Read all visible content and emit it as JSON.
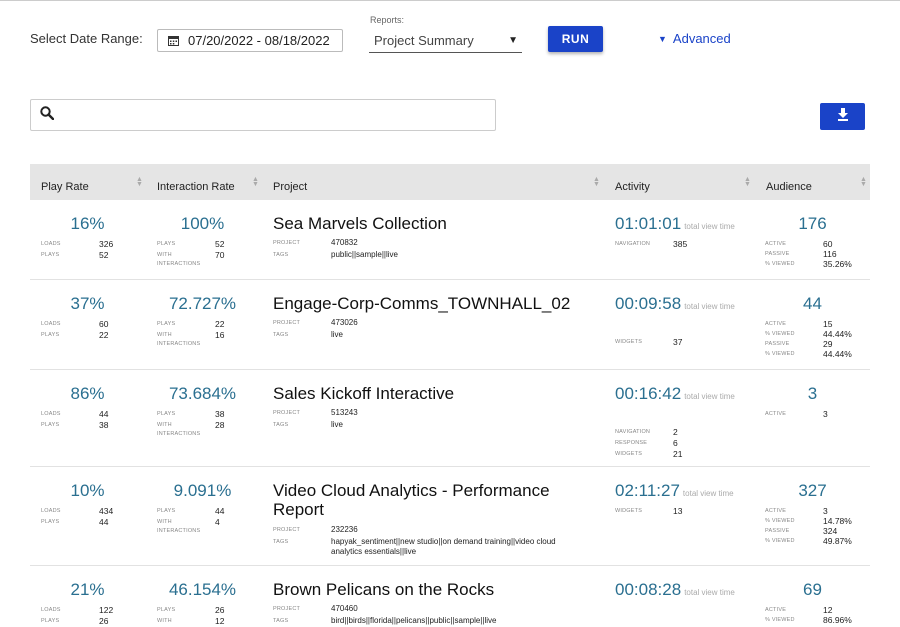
{
  "filters": {
    "date_label": "Select Date Range:",
    "date_value": "07/20/2022 - 08/18/2022",
    "reports_caption": "Reports:",
    "reports_value": "Project Summary",
    "run_label": "RUN",
    "advanced_label": "Advanced"
  },
  "search": {
    "placeholder": ""
  },
  "table": {
    "columns": [
      "Play Rate",
      "Interaction Rate",
      "Project",
      "Activity",
      "Audience"
    ],
    "rows": [
      {
        "play_rate": "16%",
        "loads": "326",
        "plays": "52",
        "interaction_rate": "100%",
        "ir_plays": "52",
        "with_interactions": "70",
        "title": "Sea Marvels Collection",
        "project": "470832",
        "tags": "public||sample||live",
        "activity_time": "01:01:01",
        "activity_label": "total view time",
        "activity_items": [
          {
            "k": "NAVIGATION",
            "v": "385"
          }
        ],
        "audience": "176",
        "audience_items": [
          {
            "k": "ACTIVE",
            "v": "60"
          },
          {
            "k": "PASSIVE",
            "v": "116"
          },
          {
            "k": "% VIEWED",
            "v": "35.26%"
          }
        ]
      },
      {
        "play_rate": "37%",
        "loads": "60",
        "plays": "22",
        "interaction_rate": "72.727%",
        "ir_plays": "22",
        "with_interactions": "16",
        "title": "Engage-Corp-Comms_TOWNHALL_02",
        "project": "473026",
        "tags": "live",
        "activity_time": "00:09:58",
        "activity_label": "total view time",
        "activity_items": [
          {
            "k": "WIDGETS",
            "v": "37"
          }
        ],
        "audience": "44",
        "audience_items": [
          {
            "k": "ACTIVE",
            "v": "15"
          },
          {
            "k": "% VIEWED",
            "v": "44.44%"
          },
          {
            "k": "PASSIVE",
            "v": "29"
          },
          {
            "k": "% VIEWED",
            "v": "44.44%"
          }
        ]
      },
      {
        "play_rate": "86%",
        "loads": "44",
        "plays": "38",
        "interaction_rate": "73.684%",
        "ir_plays": "38",
        "with_interactions": "28",
        "title": "Sales Kickoff Interactive",
        "project": "513243",
        "tags": "live",
        "activity_time": "00:16:42",
        "activity_label": "total view time",
        "activity_items": [
          {
            "k": "NAVIGATION",
            "v": "2"
          },
          {
            "k": "RESPONSE",
            "v": "6"
          },
          {
            "k": "WIDGETS",
            "v": "21"
          }
        ],
        "audience": "3",
        "audience_items": [
          {
            "k": "ACTIVE",
            "v": "3"
          }
        ]
      },
      {
        "play_rate": "10%",
        "loads": "434",
        "plays": "44",
        "interaction_rate": "9.091%",
        "ir_plays": "44",
        "with_interactions": "4",
        "title": "Video Cloud Analytics - Performance Report",
        "project": "232236",
        "tags": "hapyak_sentiment||new studio||on demand training||video cloud analytics essentials||live",
        "activity_time": "02:11:27",
        "activity_label": "total view time",
        "activity_items": [
          {
            "k": "WIDGETS",
            "v": "13"
          }
        ],
        "audience": "327",
        "audience_items": [
          {
            "k": "ACTIVE",
            "v": "3"
          },
          {
            "k": "% VIEWED",
            "v": "14.78%"
          },
          {
            "k": "PASSIVE",
            "v": "324"
          },
          {
            "k": "% VIEWED",
            "v": "49.87%"
          }
        ]
      },
      {
        "play_rate": "21%",
        "loads": "122",
        "plays": "26",
        "interaction_rate": "46.154%",
        "ir_plays": "26",
        "with_interactions": "12",
        "title": "Brown Pelicans on the Rocks",
        "project": "470460",
        "tags": "bird||birds||florida||pelicans||public||sample||live",
        "activity_time": "00:08:28",
        "activity_label": "total view time",
        "activity_items": [],
        "audience": "69",
        "audience_items": [
          {
            "k": "ACTIVE",
            "v": "12"
          },
          {
            "k": "% VIEWED",
            "v": "86.96%"
          }
        ]
      }
    ]
  }
}
